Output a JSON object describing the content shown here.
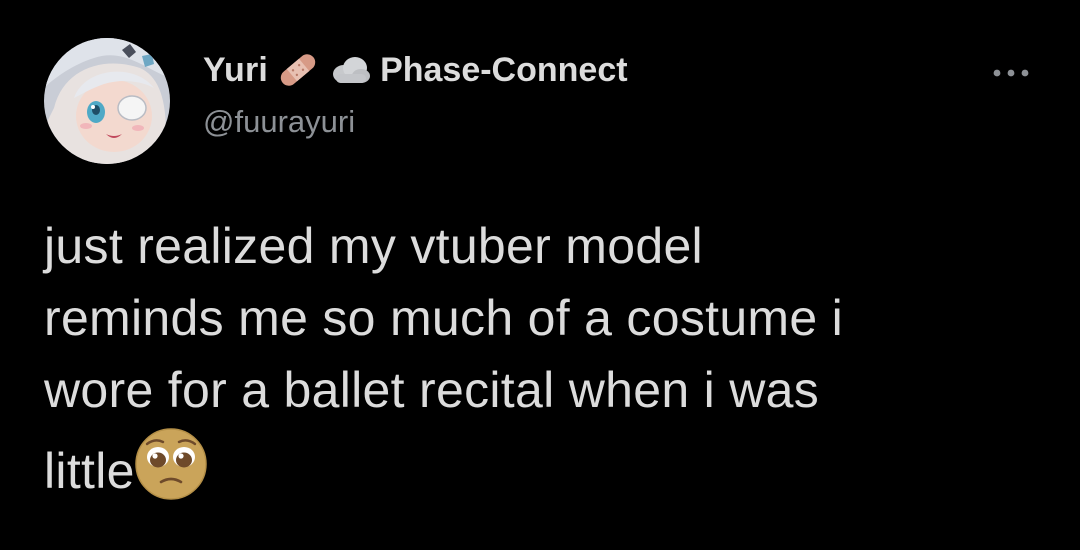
{
  "tweet": {
    "author": {
      "display_name": "Yuri",
      "badge_icons": [
        "adhesive-bandage-icon",
        "cloud-icon"
      ],
      "affiliation": "Phase-Connect",
      "handle": "@fuurayuri",
      "avatar": "anime-girl-avatar"
    },
    "more_icon": "more-options-icon",
    "text_lines": [
      "just realized my vtuber model",
      "reminds me so much of a costume i",
      "wore for a ballet recital when i was",
      "little"
    ],
    "trailing_emoji": "pleading-face-icon"
  },
  "colors": {
    "background": "#000000",
    "text": "#dcdcdc",
    "secondary_text": "#8d9196"
  }
}
